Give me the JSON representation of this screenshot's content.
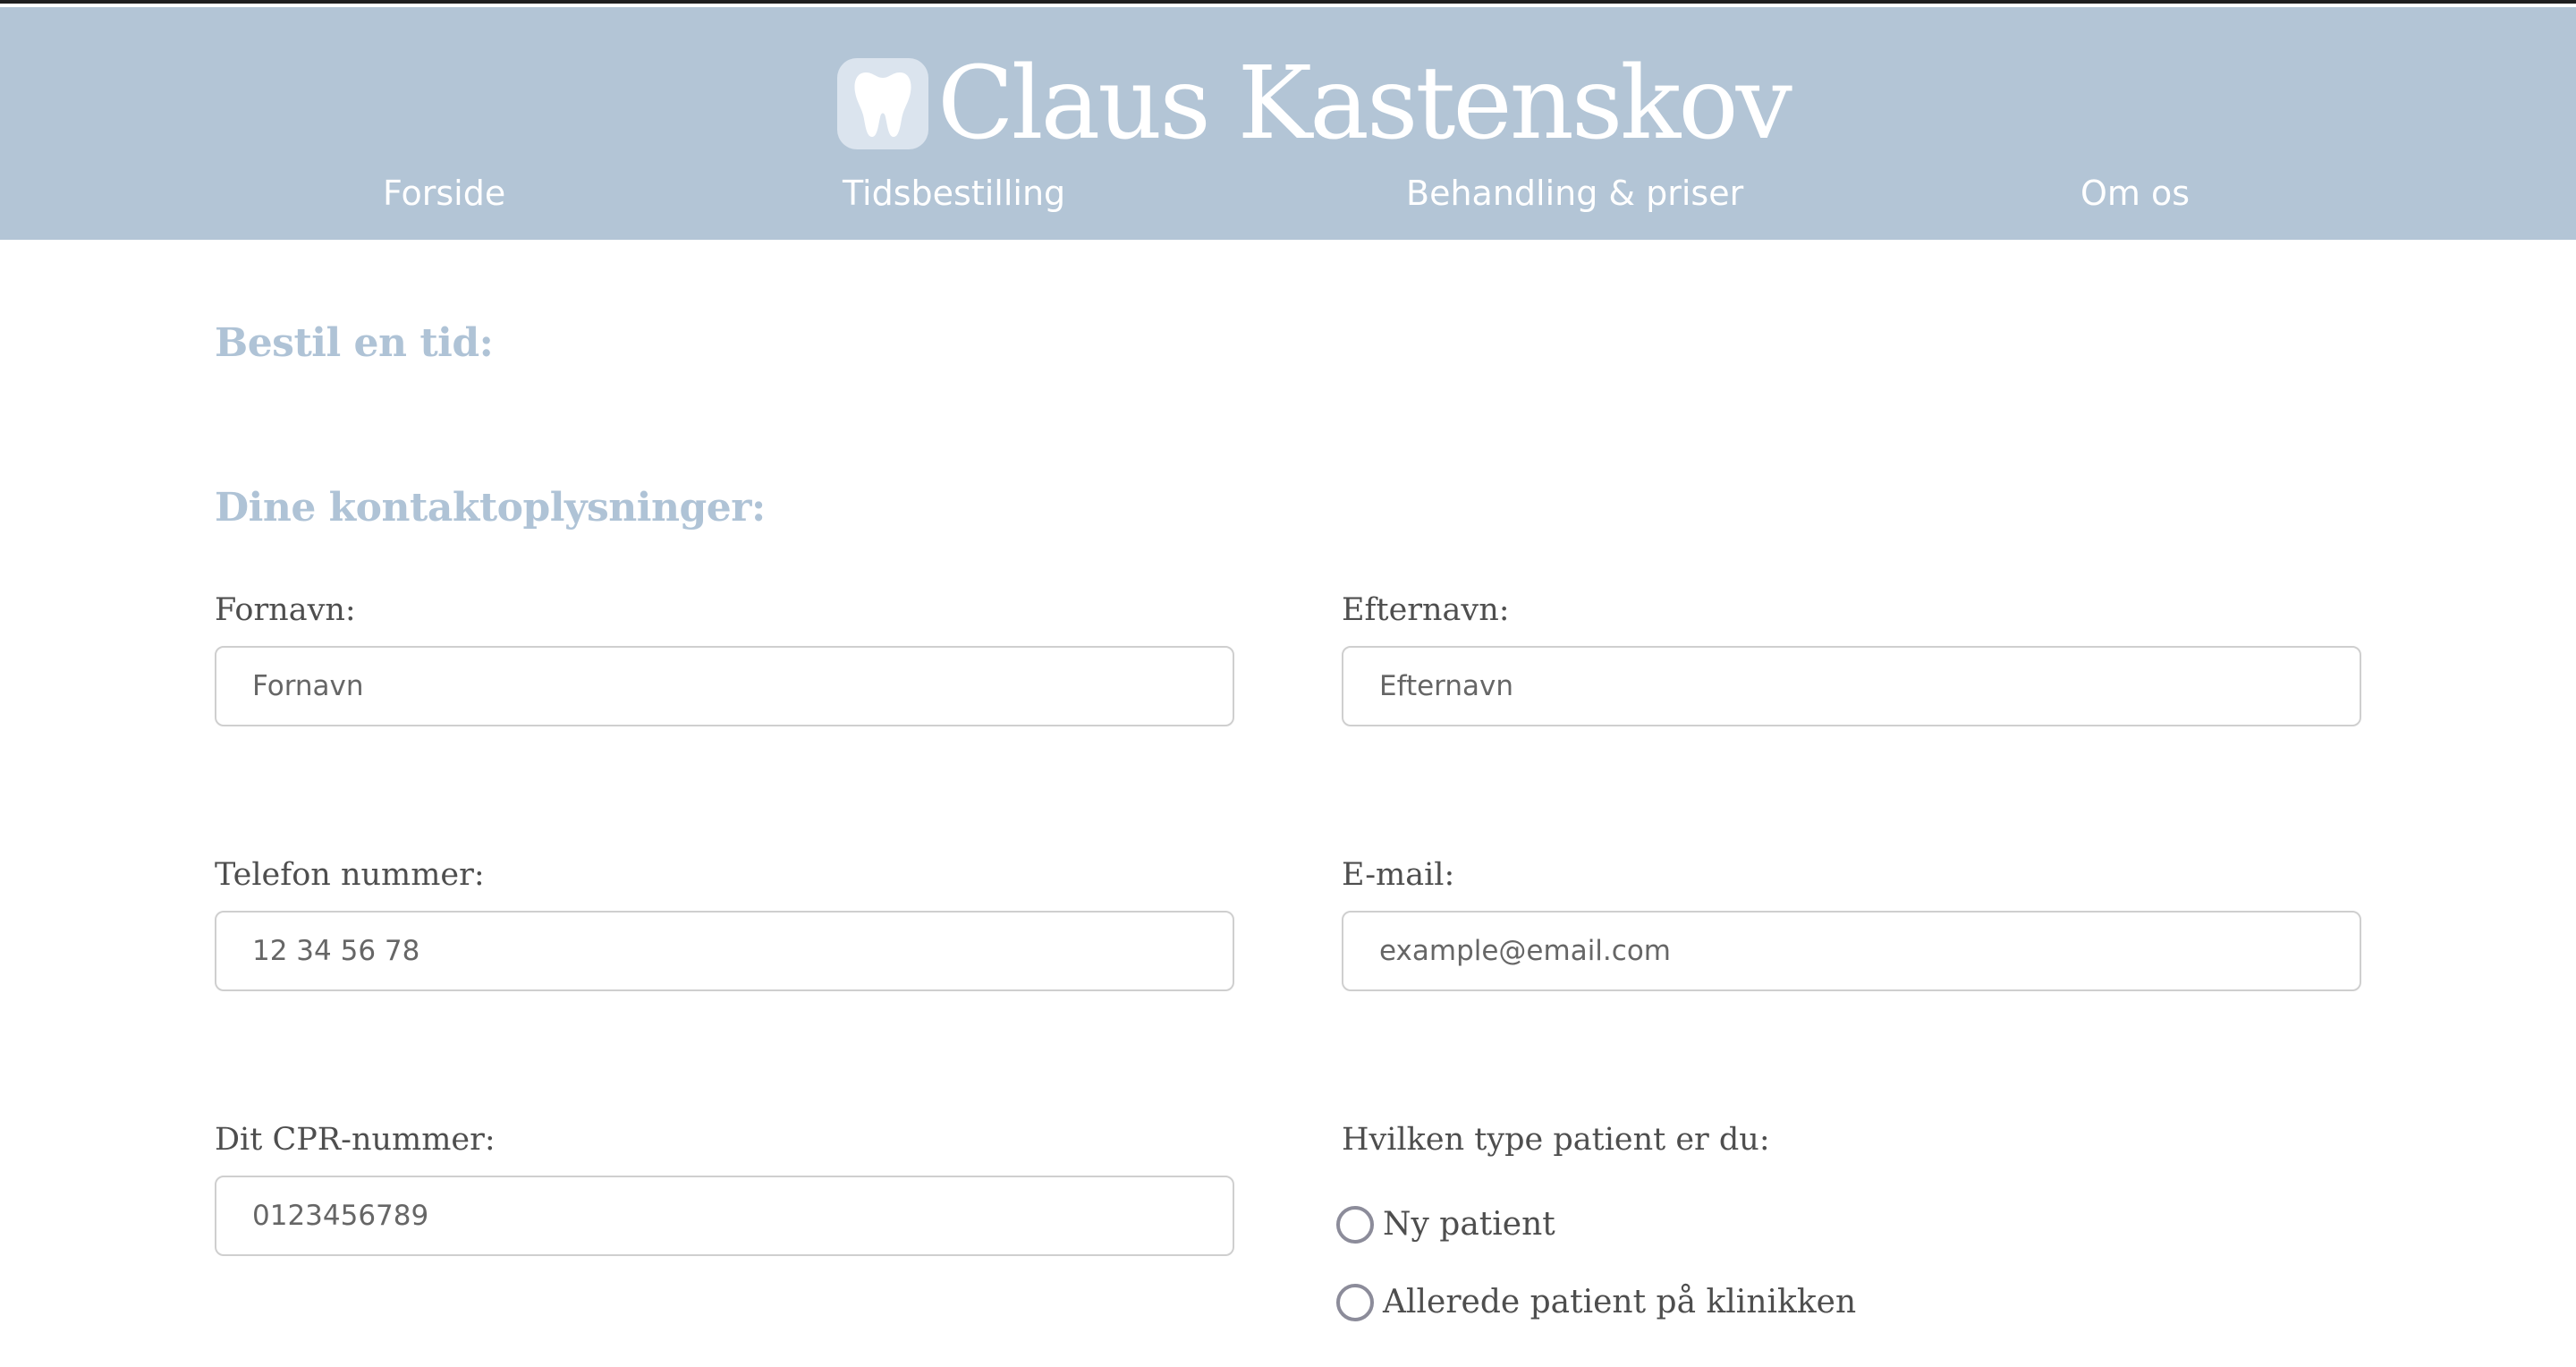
{
  "header": {
    "title": "Claus Kastenskov",
    "logo_icon": "tooth-icon",
    "background_color": "#b3c5d6",
    "nav": [
      {
        "label": "Forside"
      },
      {
        "label": "Tidsbestilling"
      },
      {
        "label": "Behandling & priser"
      },
      {
        "label": "Om os"
      }
    ]
  },
  "booking": {
    "heading": "Bestil en tid:",
    "contact_heading": "Dine kontaktoplysninger:",
    "accent_color": "#afc3d6",
    "fields": {
      "first_name": {
        "label": "Fornavn:",
        "placeholder": "Fornavn"
      },
      "last_name": {
        "label": "Efternavn:",
        "placeholder": "Efternavn"
      },
      "phone": {
        "label": "Telefon nummer:",
        "placeholder": "12 34 56 78"
      },
      "email": {
        "label": "E-mail:",
        "placeholder": "example@email.com"
      },
      "cpr": {
        "label": "Dit CPR-nummer:",
        "placeholder": "0123456789"
      }
    },
    "patient_type": {
      "label": "Hvilken type patient er du:",
      "options": [
        {
          "label": "Ny patient",
          "checked": false
        },
        {
          "label": "Allerede patient på klinikken",
          "checked": false
        }
      ]
    }
  }
}
